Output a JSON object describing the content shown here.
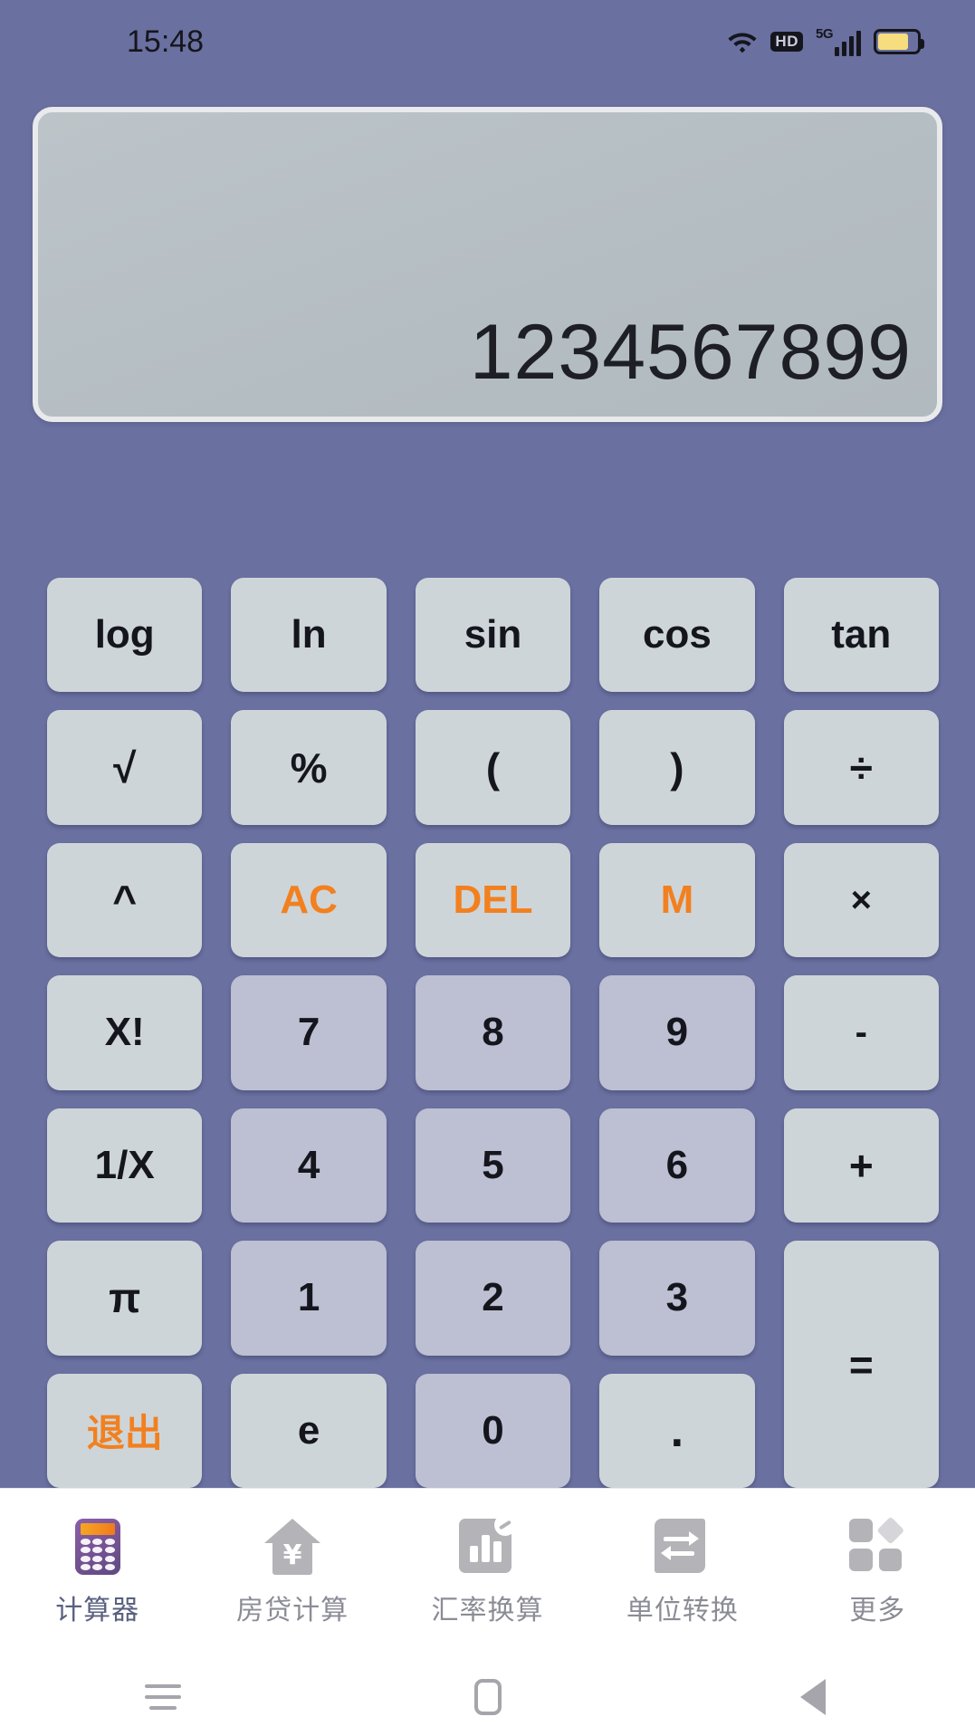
{
  "status_bar": {
    "time": "15:48",
    "icons": [
      "wifi-icon",
      "hd-icon",
      "5g-signal-icon",
      "battery-icon"
    ],
    "hd_label": "HD",
    "network_label": "5G"
  },
  "display": {
    "value": "1234567899"
  },
  "keypad": {
    "rows": [
      [
        {
          "label": "log",
          "type": "func"
        },
        {
          "label": "ln",
          "type": "func"
        },
        {
          "label": "sin",
          "type": "func"
        },
        {
          "label": "cos",
          "type": "func"
        },
        {
          "label": "tan",
          "type": "func"
        }
      ],
      [
        {
          "label": "√",
          "type": "func"
        },
        {
          "label": "%",
          "type": "func"
        },
        {
          "label": "(",
          "type": "func"
        },
        {
          "label": ")",
          "type": "func"
        },
        {
          "label": "÷",
          "type": "op"
        }
      ],
      [
        {
          "label": "^",
          "type": "func"
        },
        {
          "label": "AC",
          "type": "accent"
        },
        {
          "label": "DEL",
          "type": "accent"
        },
        {
          "label": "M",
          "type": "accent"
        },
        {
          "label": "×",
          "type": "op"
        }
      ],
      [
        {
          "label": "X!",
          "type": "func"
        },
        {
          "label": "7",
          "type": "num"
        },
        {
          "label": "8",
          "type": "num"
        },
        {
          "label": "9",
          "type": "num"
        },
        {
          "label": "-",
          "type": "op"
        }
      ],
      [
        {
          "label": "1/X",
          "type": "func"
        },
        {
          "label": "4",
          "type": "num"
        },
        {
          "label": "5",
          "type": "num"
        },
        {
          "label": "6",
          "type": "num"
        },
        {
          "label": "+",
          "type": "op"
        }
      ],
      [
        {
          "label": "π",
          "type": "func"
        },
        {
          "label": "1",
          "type": "num"
        },
        {
          "label": "2",
          "type": "num"
        },
        {
          "label": "3",
          "type": "num"
        },
        {
          "label": "=",
          "type": "equals"
        }
      ],
      [
        {
          "label": "退出",
          "type": "accent-cjk"
        },
        {
          "label": "e",
          "type": "func"
        },
        {
          "label": "0",
          "type": "num"
        },
        {
          "label": ".",
          "type": "dot"
        }
      ]
    ]
  },
  "tabbar": {
    "items": [
      {
        "label": "计算器",
        "icon": "calculator-icon",
        "active": true
      },
      {
        "label": "房贷计算",
        "icon": "house-yen-icon",
        "active": false
      },
      {
        "label": "汇率换算",
        "icon": "bar-chart-icon",
        "active": false
      },
      {
        "label": "单位转换",
        "icon": "swap-arrows-icon",
        "active": false
      },
      {
        "label": "更多",
        "icon": "grid-more-icon",
        "active": false
      }
    ]
  },
  "system_nav": {
    "recents": "menu-icon",
    "home": "home-icon",
    "back": "back-icon"
  },
  "colors": {
    "background": "#6a70a0",
    "key": "#ced5d9",
    "key_number": "#bdbfd2",
    "accent": "#f2801f",
    "display_bg": "#b6bfc4",
    "text": "#15161d",
    "tab_inactive": "#8c8c96",
    "tab_active": "#5a6080"
  }
}
